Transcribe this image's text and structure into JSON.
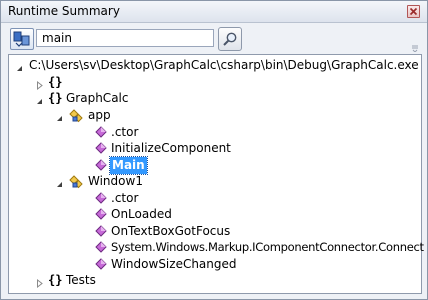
{
  "window": {
    "title": "Runtime Summary"
  },
  "toolbar": {
    "search_value": "main",
    "icons": {
      "left": "assembly-filter-icon",
      "search": "magnifier-icon",
      "close": "close-icon"
    }
  },
  "tree": {
    "root_label": "C:\\Users\\sv\\Desktop\\GraphCalc\\csharp\\bin\\Debug\\GraphCalc.exe",
    "ns_empty_label": "",
    "ns_graphcalc_label": "GraphCalc",
    "class_app_label": "app",
    "app_members": [
      ".ctor",
      "InitializeComponent",
      "Main"
    ],
    "class_window1_label": "Window1",
    "window1_members": [
      ".ctor",
      "OnLoaded",
      "OnTextBoxGotFocus",
      "System.Windows.Markup.IComponentConnector.Connect",
      "WindowSizeChanged"
    ],
    "ns_tests_label": "Tests",
    "braces": "{}"
  },
  "colors": {
    "selection": "#3399ff",
    "window_bg": "#eef1f6"
  }
}
